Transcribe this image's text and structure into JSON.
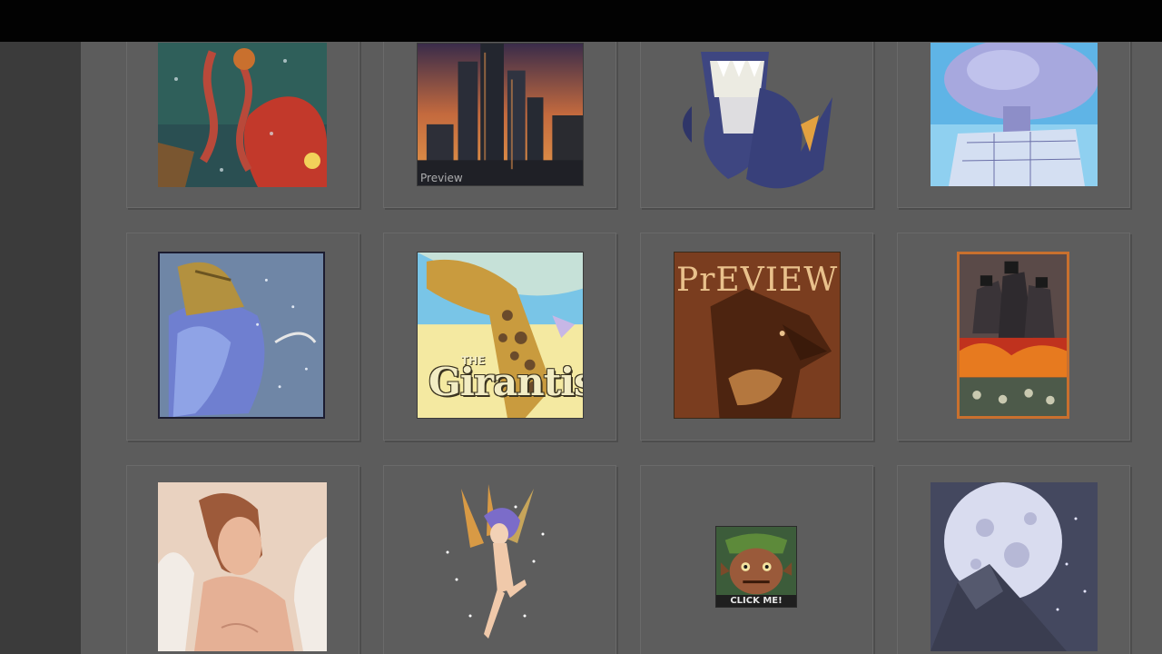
{
  "window": {
    "topbar_color": "#020202",
    "sidebar_color": "#3b3b3b",
    "background_color": "#5c5c5c"
  },
  "gallery": {
    "items": [
      {
        "id": "kraken-ship",
        "icon": "kraken-artwork",
        "overlay": ""
      },
      {
        "id": "city-sunset",
        "icon": "city-skyline-artwork",
        "overlay": "Preview"
      },
      {
        "id": "shark-creature",
        "icon": "shark-creature-artwork",
        "overlay": ""
      },
      {
        "id": "crystal-tree",
        "icon": "crystal-tree-artwork",
        "overlay": ""
      },
      {
        "id": "mammoth-rider",
        "icon": "mammoth-artwork",
        "overlay": ""
      },
      {
        "id": "girantis",
        "icon": "giraffe-artwork",
        "overlay_small": "THE",
        "overlay": "Girantis"
      },
      {
        "id": "wolf-preview",
        "icon": "wolf-artwork",
        "overlay": "PrEVIEW"
      },
      {
        "id": "dark-army",
        "icon": "dark-army-artwork",
        "overlay": ""
      },
      {
        "id": "angel-woman",
        "icon": "angel-artwork",
        "overlay": ""
      },
      {
        "id": "fairy",
        "icon": "fairy-artwork",
        "overlay": ""
      },
      {
        "id": "goblin-click",
        "icon": "goblin-artwork",
        "overlay": "CLICK ME!"
      },
      {
        "id": "moon-mountain",
        "icon": "moon-mountain-artwork",
        "overlay": ""
      }
    ]
  }
}
